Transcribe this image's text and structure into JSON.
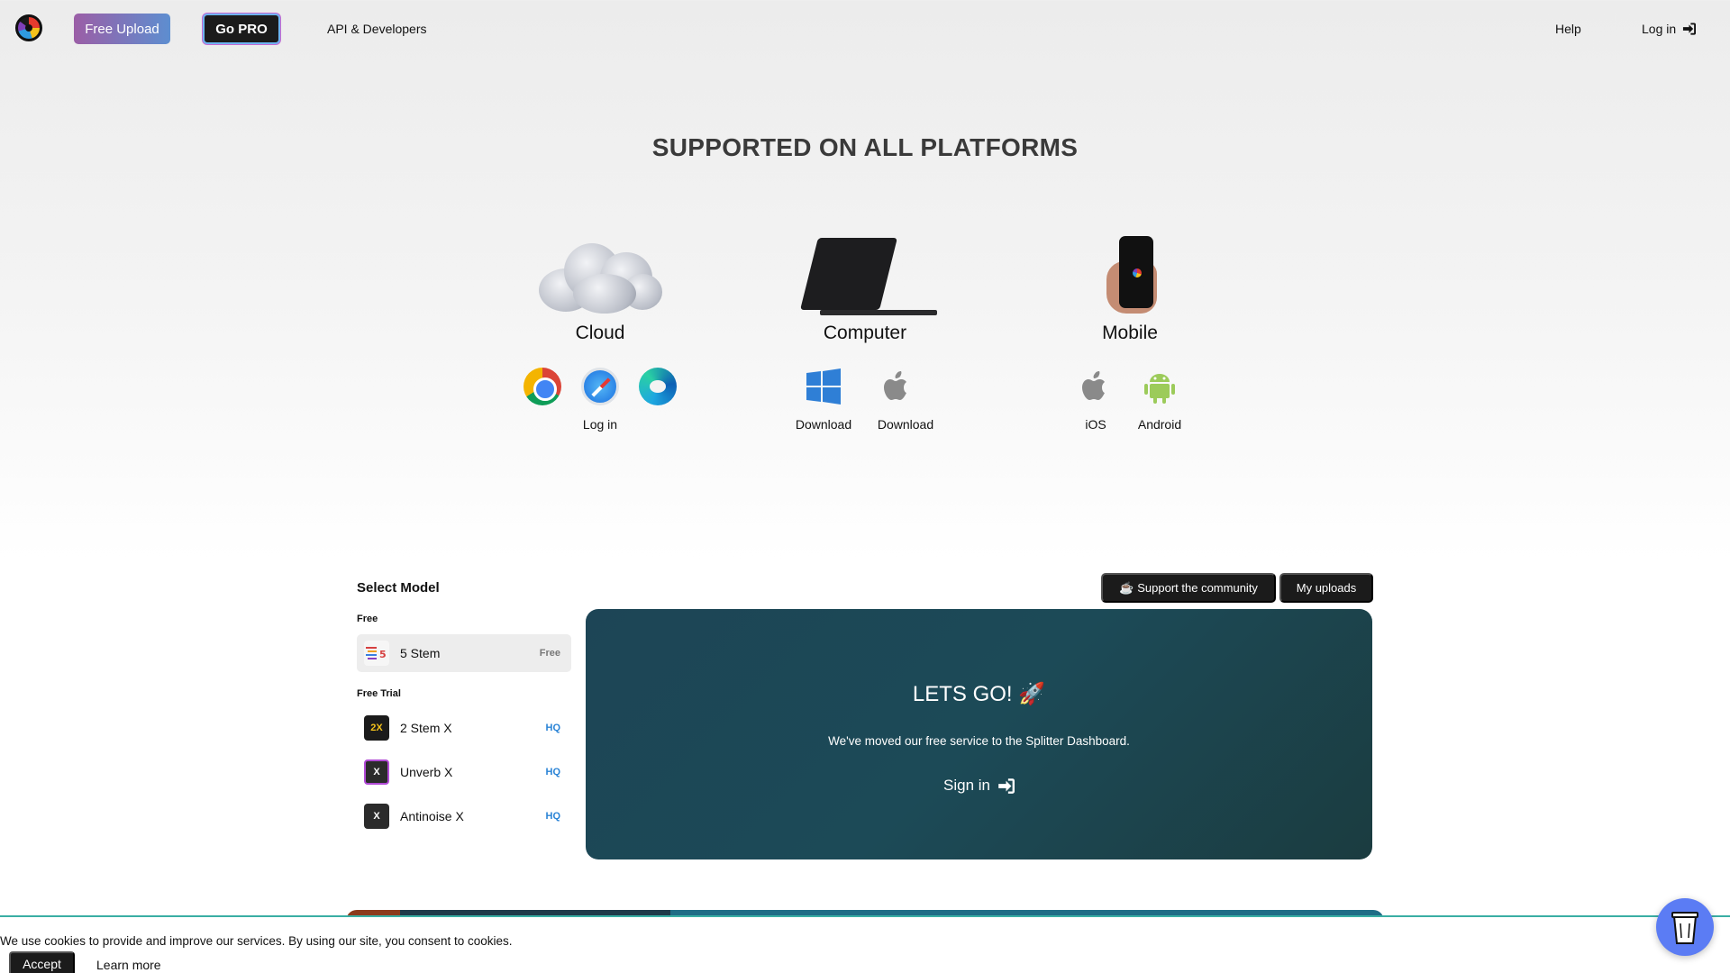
{
  "header": {
    "free_upload": "Free Upload",
    "go_pro": "Go PRO",
    "api": "API & Developers",
    "help": "Help",
    "login": "Log in"
  },
  "platforms": {
    "title": "SUPPORTED ON ALL PLATFORMS",
    "cloud": {
      "name": "Cloud",
      "label": "Log in",
      "icons": [
        "chrome-icon",
        "safari-icon",
        "edge-icon"
      ]
    },
    "computer": {
      "name": "Computer",
      "windows_label": "Download",
      "mac_label": "Download"
    },
    "mobile": {
      "name": "Mobile",
      "ios_label": "iOS",
      "android_label": "Android"
    }
  },
  "models": {
    "title": "Select Model",
    "free_label": "Free",
    "trial_label": "Free Trial",
    "free": [
      {
        "name": "5 Stem",
        "badge": "Free",
        "icon_text": "5"
      }
    ],
    "trial": [
      {
        "name": "2 Stem X",
        "badge": "HQ",
        "icon_text": "2X"
      },
      {
        "name": "Unverb X",
        "badge": "HQ",
        "icon_text": "X"
      },
      {
        "name": "Antinoise X",
        "badge": "HQ",
        "icon_text": "X"
      }
    ]
  },
  "actions": {
    "support": "Support the community",
    "uploads": "My uploads"
  },
  "card": {
    "title": "LETS GO! 🚀",
    "text": "We've moved our free service to the Splitter Dashboard.",
    "signin": "Sign in"
  },
  "cookie": {
    "text": "We use cookies to provide and improve our services. By using our site, you consent to cookies.",
    "accept": "Accept",
    "learn_more": "Learn more"
  },
  "colors": {
    "accent_teal": "#1d4556",
    "hq_blue": "#2b84d6",
    "coffee_button": "#5b7cf4"
  }
}
